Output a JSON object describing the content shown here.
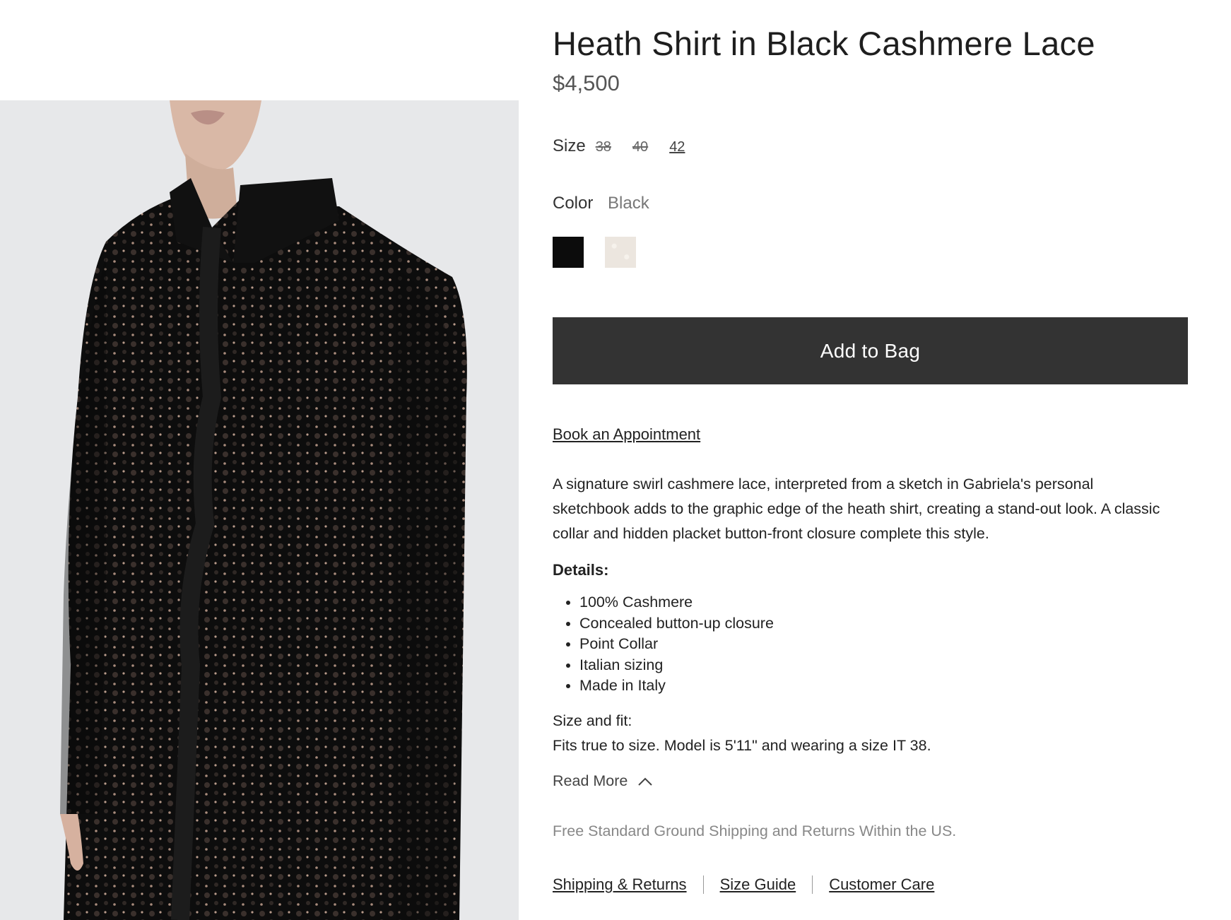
{
  "product": {
    "title": "Heath Shirt in Black Cashmere Lace",
    "price": "$4,500"
  },
  "size": {
    "label": "Size",
    "options": [
      {
        "label": "38",
        "available": false
      },
      {
        "label": "40",
        "available": false
      },
      {
        "label": "42",
        "available": true
      }
    ]
  },
  "color": {
    "label": "Color",
    "selected": "Black",
    "swatches": [
      {
        "name": "black",
        "hex": "#0c0c0c"
      },
      {
        "name": "ivory",
        "hex": "#ece6df"
      }
    ]
  },
  "actions": {
    "add_to_bag": "Add to Bag",
    "book_appointment": "Book an Appointment"
  },
  "description": "A signature swirl cashmere lace, interpreted from a sketch in Gabriela's personal sketchbook adds to the graphic edge of the heath shirt, creating a stand-out look. A classic collar and hidden placket button-front closure complete this style.",
  "details": {
    "heading": "Details:",
    "items": [
      "100% Cashmere",
      "Concealed button-up closure",
      "Point Collar",
      "Italian sizing",
      "Made in Italy"
    ]
  },
  "fit": {
    "heading": "Size and fit:",
    "text": "Fits true to size. Model is 5'11\" and wearing a size IT 38."
  },
  "read_more": {
    "label": "Read More",
    "icon": "chevron-up-icon"
  },
  "shipping_note": "Free Standard Ground Shipping and Returns Within the US.",
  "footer_links": [
    "Shipping & Returns",
    "Size Guide",
    "Customer Care"
  ],
  "colors": {
    "button_bg": "#333333",
    "image_bg": "#e7e8ea",
    "muted_text": "#888888"
  }
}
